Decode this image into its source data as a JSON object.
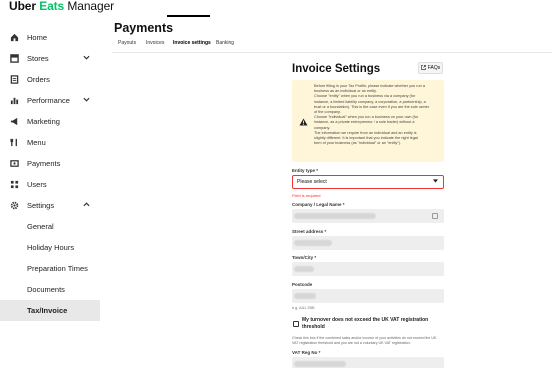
{
  "brand": {
    "part1": "Uber ",
    "part2": "Eats",
    "part3": " Manager"
  },
  "sidebar": {
    "items": [
      {
        "label": "Home",
        "icon": "home-icon"
      },
      {
        "label": "Stores",
        "icon": "store-icon",
        "chevron": "down"
      },
      {
        "label": "Orders",
        "icon": "orders-icon"
      },
      {
        "label": "Performance",
        "icon": "chart-icon",
        "chevron": "down"
      },
      {
        "label": "Marketing",
        "icon": "megaphone-icon"
      },
      {
        "label": "Menu",
        "icon": "menu-icon"
      },
      {
        "label": "Payments",
        "icon": "payments-icon"
      },
      {
        "label": "Users",
        "icon": "users-icon"
      },
      {
        "label": "Settings",
        "icon": "gear-icon",
        "chevron": "up"
      },
      {
        "label": "General"
      },
      {
        "label": "Holiday Hours"
      },
      {
        "label": "Preparation Times"
      },
      {
        "label": "Documents"
      },
      {
        "label": "Tax/Invoice"
      }
    ],
    "active": "Tax/Invoice"
  },
  "page": {
    "title": "Payments",
    "tabs": [
      "Payouts",
      "Invoices",
      "Invoice settings",
      "Banking"
    ],
    "active_tab": "Invoice settings"
  },
  "invoice": {
    "title": "Invoice Settings",
    "faq_label": "FAQs",
    "warning_lines": [
      "Before filling in your Tax Profile, please indicate whether you run a",
      "business as an individual or an entity.",
      "Choose \"entity\" when you run a business via a company (for",
      "instance, a limited liability company, a corporation, a partnership, a",
      "trust or a foundation). This is the case even if you are the sole owner",
      "of the company.",
      "Choose \"individual\" when you run a business on your own (for",
      "instance, as a private entrepreneur / a sole trader) without a",
      "company.",
      "The information we require from an individual and an entity is",
      "slightly different. It is important that you indicate the right legal",
      "form of your business (as \"individual\" or an \"entity\")."
    ],
    "entity_label": "Entity type *",
    "entity_value": "Please select",
    "entity_error": "Field is required",
    "company_label": "Company / Legal Name *",
    "street_label": "Street address *",
    "town_label": "Town/City *",
    "postcode_label": "Postcode",
    "postcode_hint": "e.g. AA1 2BB",
    "vat_checkbox_label": "My turnover does not exceed the UK VAT registration threshold",
    "vat_help": "Check this box if the combined sales and/or income of your activities do not exceed the UK VAT registration threshold and you are not a voluntary UK VAT registration.",
    "vat_label": "VAT Reg No *"
  },
  "colors": {
    "brand_green": "#06c167",
    "warning_bg": "#fff5d9",
    "error": "#e33333"
  }
}
